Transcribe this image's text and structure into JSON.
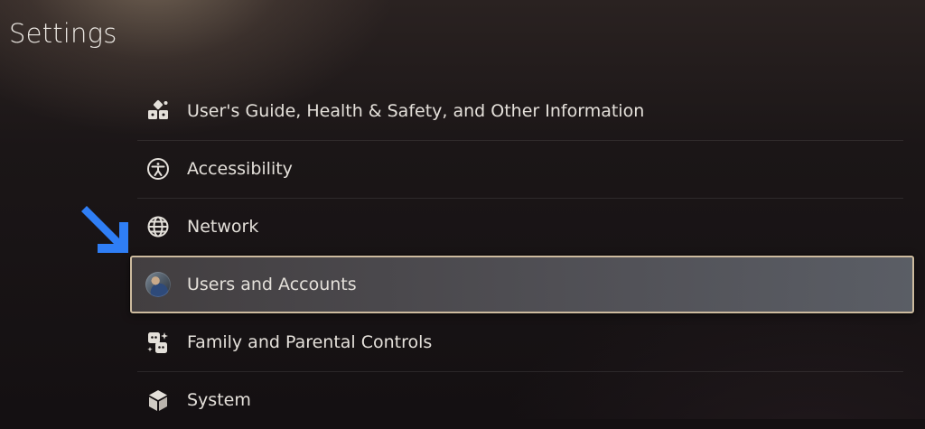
{
  "header": {
    "title": "Settings"
  },
  "menu": {
    "items": [
      {
        "label": "User's Guide, Health & Safety, and Other Information",
        "icon": "guide-icon"
      },
      {
        "label": "Accessibility",
        "icon": "accessibility-icon"
      },
      {
        "label": "Network",
        "icon": "globe-icon"
      },
      {
        "label": "Users and Accounts",
        "icon": "user-avatar",
        "selected": true
      },
      {
        "label": "Family and Parental Controls",
        "icon": "family-icon"
      },
      {
        "label": "System",
        "icon": "cube-icon"
      }
    ]
  },
  "annotation": {
    "icon": "arrow-down-right-icon",
    "color": "#2f7ef5"
  },
  "colors": {
    "selection_border": "#cdbb9f",
    "text": "#e4e0da"
  }
}
